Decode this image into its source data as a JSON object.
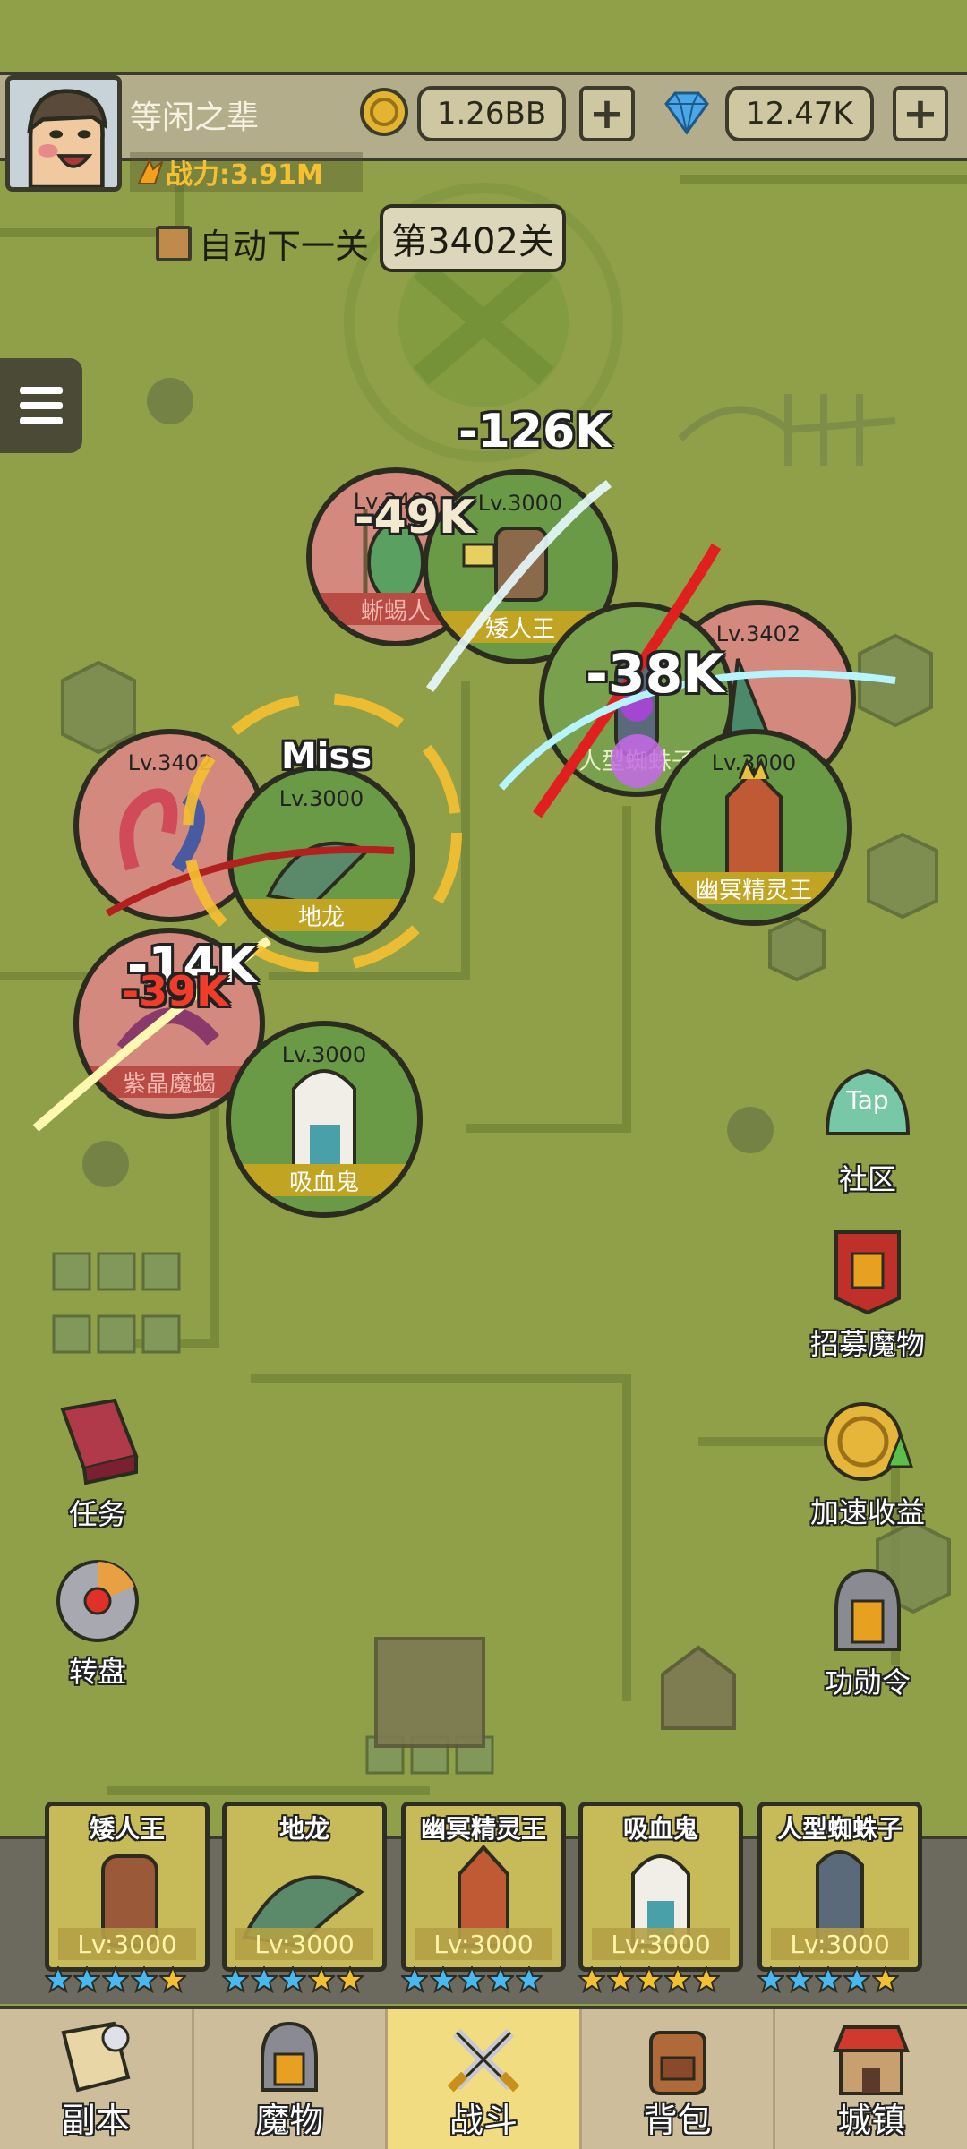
{
  "player": {
    "name": "等闲之辈",
    "power": "战力:3.91M"
  },
  "resources": {
    "gold": "1.26BB",
    "gems": "12.47K",
    "plus_label": "+"
  },
  "stage": {
    "auto_next_label": "自动下一关",
    "current": "第3402关"
  },
  "battle": {
    "units": [
      {
        "name": "蜥蜴人",
        "level": "Lv.3402",
        "side": "enemy"
      },
      {
        "name": "矮人王",
        "level": "Lv.3000",
        "side": "ally"
      },
      {
        "name": "人型蜘蛛子",
        "level": "Lv.3402",
        "side": "enemy"
      },
      {
        "name": "幽冥精灵王",
        "level": "Lv.3000",
        "side": "ally"
      },
      {
        "name": "",
        "level": "Lv.3402",
        "side": "enemy"
      },
      {
        "name": "地龙",
        "level": "Lv.3000",
        "side": "ally"
      },
      {
        "name": "紫晶魔蝎",
        "level": "Lv.3402",
        "side": "enemy"
      },
      {
        "name": "吸血鬼",
        "level": "Lv.3000",
        "side": "ally"
      }
    ],
    "damage": [
      "-126K",
      "-49K",
      "-38K",
      "-14K",
      "-39K"
    ],
    "miss_label": "Miss"
  },
  "side_buttons": {
    "community": "社区",
    "community_tag": "Tap",
    "recruit": "招募魔物",
    "speed_up": "加速收益",
    "merit": "功勋令",
    "tasks": "任务",
    "wheel": "转盘"
  },
  "heroes": [
    {
      "name": "矮人王",
      "level": "Lv:3000",
      "stars_blue": 4,
      "stars_gold": 1
    },
    {
      "name": "地龙",
      "level": "Lv:3000",
      "stars_blue": 3,
      "stars_gold": 2
    },
    {
      "name": "幽冥精灵王",
      "level": "Lv:3000",
      "stars_blue": 5,
      "stars_gold": 0
    },
    {
      "name": "吸血鬼",
      "level": "Lv:3000",
      "stars_blue": 0,
      "stars_gold": 5
    },
    {
      "name": "人型蜘蛛子",
      "level": "Lv:3000",
      "stars_blue": 4,
      "stars_gold": 1
    }
  ],
  "nav": {
    "tabs": [
      "副本",
      "魔物",
      "战斗",
      "背包",
      "城镇"
    ],
    "active": "战斗"
  },
  "colors": {
    "map": "#8fa048",
    "ally_ring": "#6b9a46",
    "enemy_ring": "#d3897d",
    "gold_band": "#c1a422",
    "nav_active": "#f2dc82"
  }
}
